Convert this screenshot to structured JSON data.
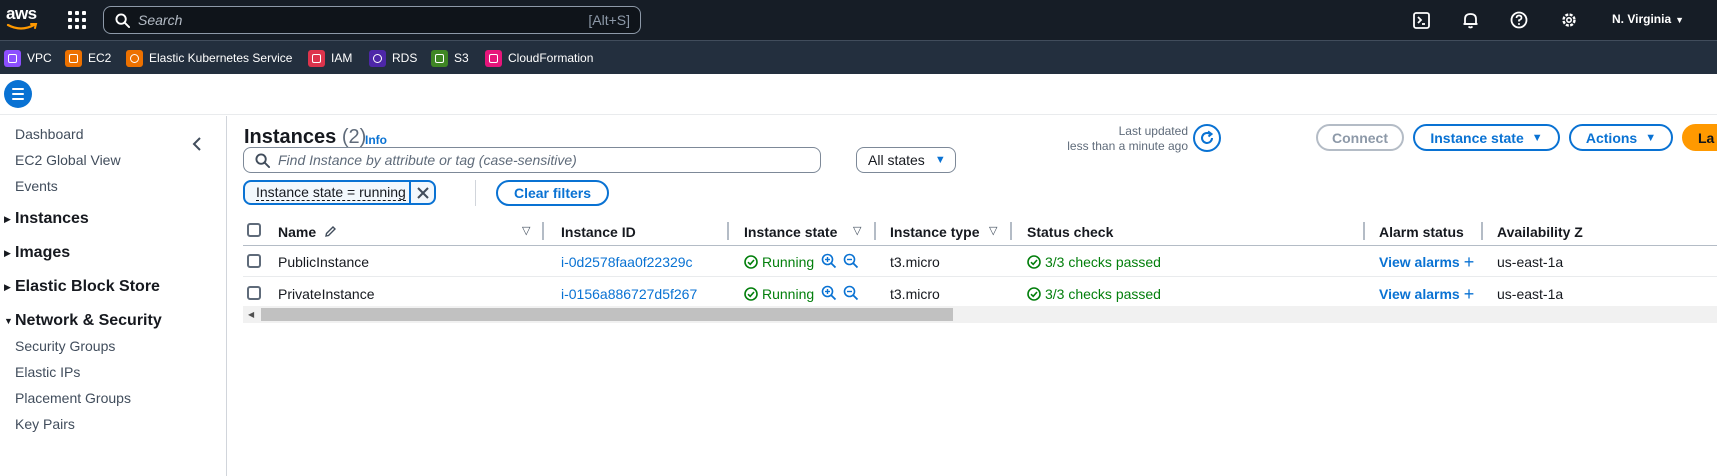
{
  "topnav": {
    "logo_text": "aws",
    "search_placeholder": "Search",
    "search_shortcut": "[Alt+S]",
    "region": "N. Virginia",
    "icons": [
      "apps-grid-icon",
      "search-icon",
      "cloudshell-icon",
      "bell-icon",
      "help-icon",
      "gear-icon"
    ]
  },
  "favorites": [
    {
      "label": "VPC",
      "color": "#8c4fff"
    },
    {
      "label": "EC2",
      "color": "#ed7100"
    },
    {
      "label": "Elastic Kubernetes Service",
      "color": "#ed7100"
    },
    {
      "label": "IAM",
      "color": "#dd344c"
    },
    {
      "label": "RDS",
      "color": "#4d27a8"
    },
    {
      "label": "S3",
      "color": "#3f8624"
    },
    {
      "label": "CloudFormation",
      "color": "#e7157b"
    }
  ],
  "sidebar": {
    "items": [
      "Dashboard",
      "EC2 Global View",
      "Events"
    ],
    "sections": [
      {
        "label": "Instances",
        "expanded": false
      },
      {
        "label": "Images",
        "expanded": false
      },
      {
        "label": "Elastic Block Store",
        "expanded": false
      },
      {
        "label": "Network & Security",
        "expanded": true
      }
    ],
    "network_items": [
      "Security Groups",
      "Elastic IPs",
      "Placement Groups",
      "Key Pairs"
    ]
  },
  "header": {
    "title": "Instances",
    "count": "(2)",
    "info": "Info",
    "last_updated_label": "Last updated",
    "last_updated_value": "less than a minute ago",
    "connect": "Connect",
    "instance_state": "Instance state",
    "actions": "Actions",
    "launch_partial": "La"
  },
  "filters": {
    "search_placeholder": "Find Instance by attribute or tag (case-sensitive)",
    "states_select": "All states",
    "token": "Instance state = running",
    "clear": "Clear filters"
  },
  "table": {
    "columns": [
      "Name",
      "Instance ID",
      "Instance state",
      "Instance type",
      "Status check",
      "Alarm status",
      "Availability Z"
    ],
    "rows": [
      {
        "name": "PublicInstance",
        "id": "i-0d2578faa0f22329c",
        "state": "Running",
        "type": "t3.micro",
        "status": "3/3 checks passed",
        "alarm": "View alarms",
        "az": "us-east-1a"
      },
      {
        "name": "PrivateInstance",
        "id": "i-0156a886727d5f267",
        "state": "Running",
        "type": "t3.micro",
        "status": "3/3 checks passed",
        "alarm": "View alarms",
        "az": "us-east-1a"
      }
    ]
  },
  "colors": {
    "nav_bg": "#161d26",
    "fav_bg": "#232f3e",
    "link": "#0972d3",
    "success": "#037f0c",
    "primary": "#ff9900"
  }
}
